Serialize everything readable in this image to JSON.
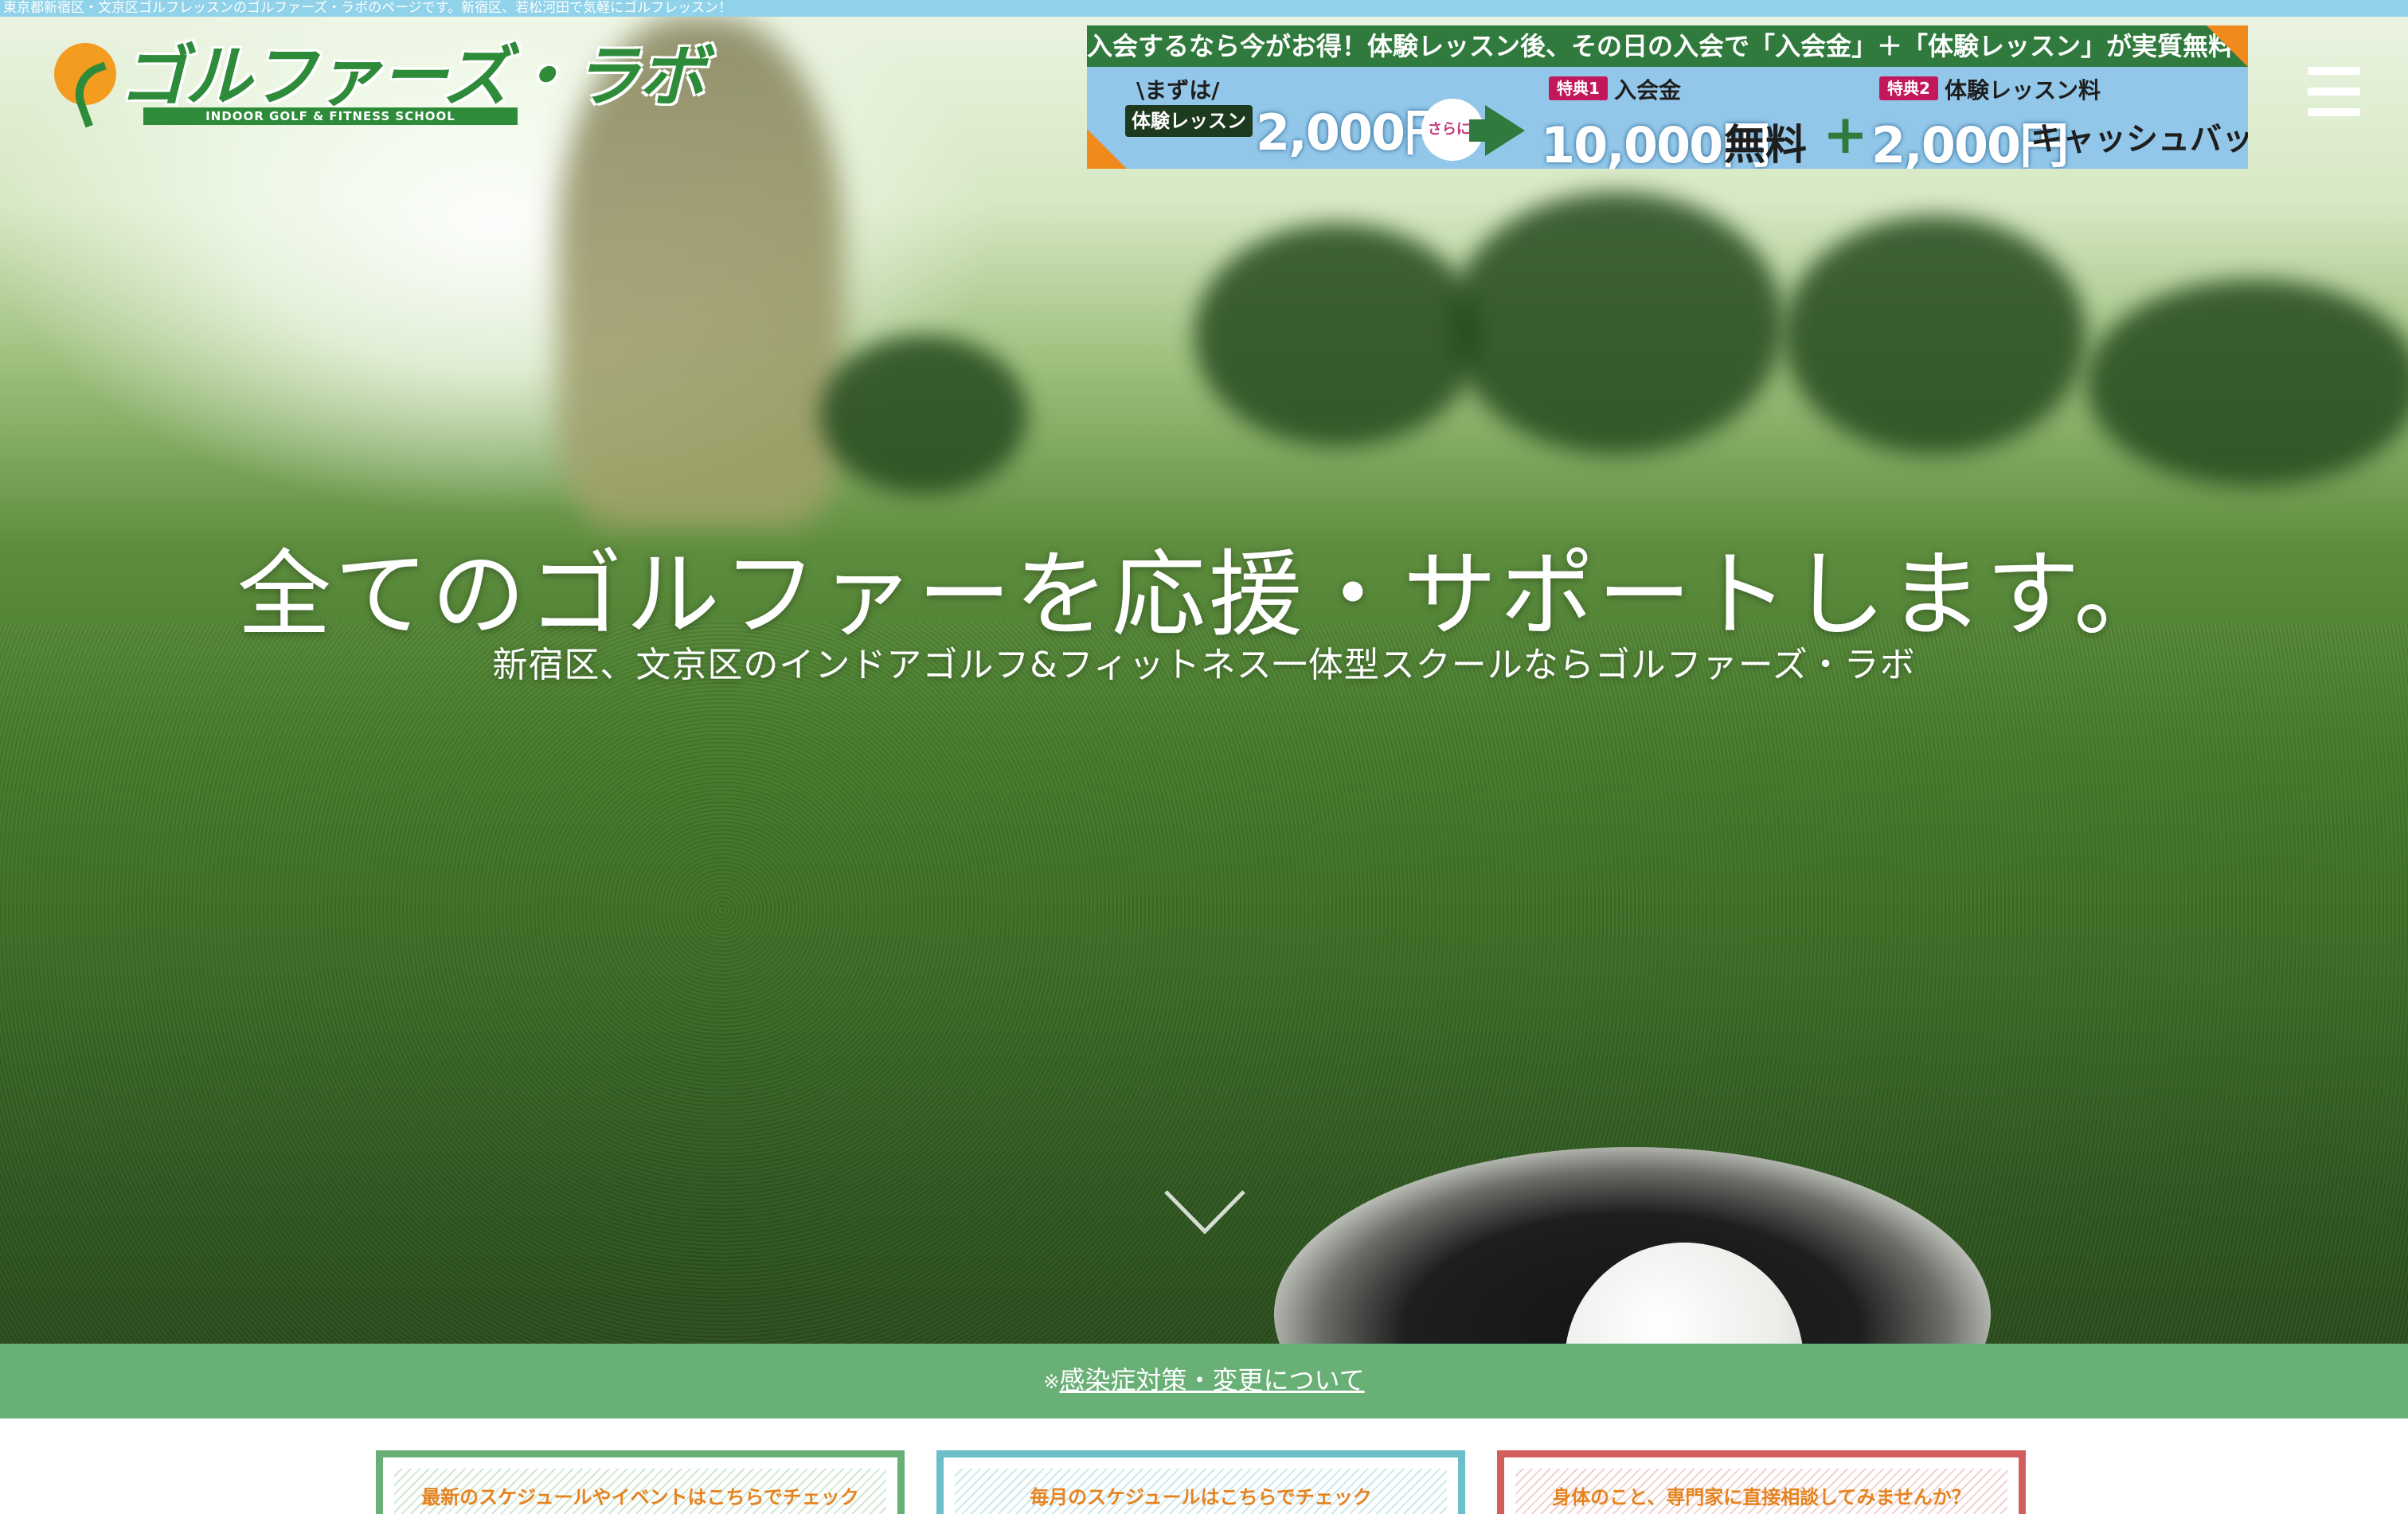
{
  "topbar": {
    "text": "東京都新宿区・文京区ゴルフレッスンのゴルファーズ・ラボのページです。新宿区、若松河田で気軽にゴルフレッスン！"
  },
  "logo": {
    "name": "ゴルファーズ・ラボ",
    "subtitle": "INDOOR GOLF & FITNESS SCHOOL"
  },
  "banner": {
    "headline": "入会するなら今がお得！体験レッスン後、その日の入会で「入会金」＋「体験レッスン」が実質無料！",
    "first_label": "\\まずは/",
    "trial_label": "体験レッスン",
    "trial_price": "2,000円",
    "more_label": "さらに!",
    "tokuten1_tag": "特典1",
    "tokuten1_label": "入会金",
    "tokuten1_price": "10,000円",
    "tokuten1_suffix": "無料",
    "plus": "+",
    "tokuten2_tag": "特典2",
    "tokuten2_label": "体験レッスン料",
    "tokuten2_price": "2,000円",
    "tokuten2_suffix": "キャッシュバック"
  },
  "hero": {
    "headline": "全てのゴルファーを応援・サポートします。",
    "subheadline": "新宿区、文京区のインドアゴルフ&フィットネス一体型スクールならゴルファーズ・ラボ"
  },
  "notice": {
    "mark": "※",
    "link_text": "感染症対策・変更について"
  },
  "cards": [
    {
      "label": "最新のスケジュールやイベントはこちらでチェック"
    },
    {
      "label": "毎月のスケジュールはこちらでチェック"
    },
    {
      "label": "身体のこと、専門家に直接相談してみませんか？"
    }
  ],
  "icons": {
    "menu": "hamburger-menu-icon",
    "scroll": "chevron-down-icon"
  },
  "colors": {
    "brand_green": "#2e8b3a",
    "brand_orange": "#f39c1f",
    "topbar": "#8fd2ea",
    "notice_bar": "#69b077",
    "card_green": "#69b077",
    "card_teal": "#6cbec9",
    "card_red": "#d35e5e",
    "card_text": "#e6831f"
  }
}
